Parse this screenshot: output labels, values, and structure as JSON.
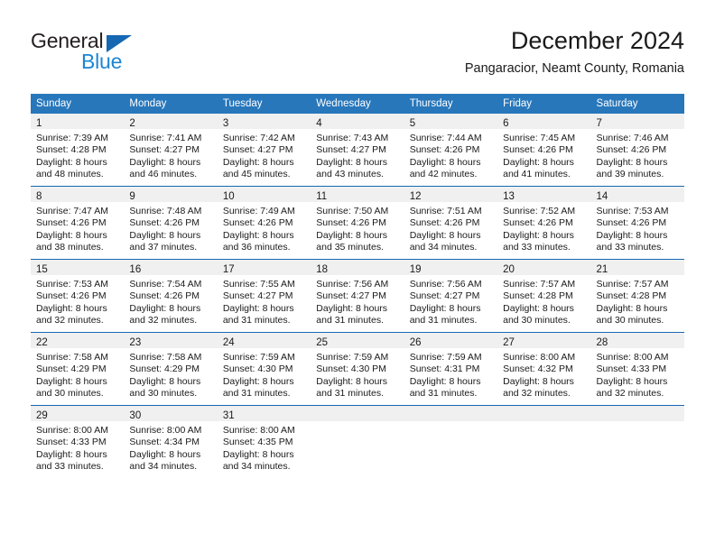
{
  "brand": {
    "name_top": "General",
    "name_bottom": "Blue",
    "color_dark": "#231f20",
    "color_blue": "#1b86d4"
  },
  "header": {
    "title": "December 2024",
    "subtitle": "Pangaracior, Neamt County, Romania"
  },
  "theme": {
    "header_bg": "#2877bb",
    "header_text": "#ffffff",
    "row_divider": "#1668b3",
    "daynum_bg": "#f0f0f0"
  },
  "weekdays": [
    "Sunday",
    "Monday",
    "Tuesday",
    "Wednesday",
    "Thursday",
    "Friday",
    "Saturday"
  ],
  "labels": {
    "sunrise_prefix": "Sunrise:",
    "sunset_prefix": "Sunset:",
    "daylight_prefix": "Daylight:"
  },
  "weeks": [
    [
      {
        "day": "1",
        "l1": "Sunrise: 7:39 AM",
        "l2": "Sunset: 4:28 PM",
        "l3": "Daylight: 8 hours",
        "l4": "and 48 minutes."
      },
      {
        "day": "2",
        "l1": "Sunrise: 7:41 AM",
        "l2": "Sunset: 4:27 PM",
        "l3": "Daylight: 8 hours",
        "l4": "and 46 minutes."
      },
      {
        "day": "3",
        "l1": "Sunrise: 7:42 AM",
        "l2": "Sunset: 4:27 PM",
        "l3": "Daylight: 8 hours",
        "l4": "and 45 minutes."
      },
      {
        "day": "4",
        "l1": "Sunrise: 7:43 AM",
        "l2": "Sunset: 4:27 PM",
        "l3": "Daylight: 8 hours",
        "l4": "and 43 minutes."
      },
      {
        "day": "5",
        "l1": "Sunrise: 7:44 AM",
        "l2": "Sunset: 4:26 PM",
        "l3": "Daylight: 8 hours",
        "l4": "and 42 minutes."
      },
      {
        "day": "6",
        "l1": "Sunrise: 7:45 AM",
        "l2": "Sunset: 4:26 PM",
        "l3": "Daylight: 8 hours",
        "l4": "and 41 minutes."
      },
      {
        "day": "7",
        "l1": "Sunrise: 7:46 AM",
        "l2": "Sunset: 4:26 PM",
        "l3": "Daylight: 8 hours",
        "l4": "and 39 minutes."
      }
    ],
    [
      {
        "day": "8",
        "l1": "Sunrise: 7:47 AM",
        "l2": "Sunset: 4:26 PM",
        "l3": "Daylight: 8 hours",
        "l4": "and 38 minutes."
      },
      {
        "day": "9",
        "l1": "Sunrise: 7:48 AM",
        "l2": "Sunset: 4:26 PM",
        "l3": "Daylight: 8 hours",
        "l4": "and 37 minutes."
      },
      {
        "day": "10",
        "l1": "Sunrise: 7:49 AM",
        "l2": "Sunset: 4:26 PM",
        "l3": "Daylight: 8 hours",
        "l4": "and 36 minutes."
      },
      {
        "day": "11",
        "l1": "Sunrise: 7:50 AM",
        "l2": "Sunset: 4:26 PM",
        "l3": "Daylight: 8 hours",
        "l4": "and 35 minutes."
      },
      {
        "day": "12",
        "l1": "Sunrise: 7:51 AM",
        "l2": "Sunset: 4:26 PM",
        "l3": "Daylight: 8 hours",
        "l4": "and 34 minutes."
      },
      {
        "day": "13",
        "l1": "Sunrise: 7:52 AM",
        "l2": "Sunset: 4:26 PM",
        "l3": "Daylight: 8 hours",
        "l4": "and 33 minutes."
      },
      {
        "day": "14",
        "l1": "Sunrise: 7:53 AM",
        "l2": "Sunset: 4:26 PM",
        "l3": "Daylight: 8 hours",
        "l4": "and 33 minutes."
      }
    ],
    [
      {
        "day": "15",
        "l1": "Sunrise: 7:53 AM",
        "l2": "Sunset: 4:26 PM",
        "l3": "Daylight: 8 hours",
        "l4": "and 32 minutes."
      },
      {
        "day": "16",
        "l1": "Sunrise: 7:54 AM",
        "l2": "Sunset: 4:26 PM",
        "l3": "Daylight: 8 hours",
        "l4": "and 32 minutes."
      },
      {
        "day": "17",
        "l1": "Sunrise: 7:55 AM",
        "l2": "Sunset: 4:27 PM",
        "l3": "Daylight: 8 hours",
        "l4": "and 31 minutes."
      },
      {
        "day": "18",
        "l1": "Sunrise: 7:56 AM",
        "l2": "Sunset: 4:27 PM",
        "l3": "Daylight: 8 hours",
        "l4": "and 31 minutes."
      },
      {
        "day": "19",
        "l1": "Sunrise: 7:56 AM",
        "l2": "Sunset: 4:27 PM",
        "l3": "Daylight: 8 hours",
        "l4": "and 31 minutes."
      },
      {
        "day": "20",
        "l1": "Sunrise: 7:57 AM",
        "l2": "Sunset: 4:28 PM",
        "l3": "Daylight: 8 hours",
        "l4": "and 30 minutes."
      },
      {
        "day": "21",
        "l1": "Sunrise: 7:57 AM",
        "l2": "Sunset: 4:28 PM",
        "l3": "Daylight: 8 hours",
        "l4": "and 30 minutes."
      }
    ],
    [
      {
        "day": "22",
        "l1": "Sunrise: 7:58 AM",
        "l2": "Sunset: 4:29 PM",
        "l3": "Daylight: 8 hours",
        "l4": "and 30 minutes."
      },
      {
        "day": "23",
        "l1": "Sunrise: 7:58 AM",
        "l2": "Sunset: 4:29 PM",
        "l3": "Daylight: 8 hours",
        "l4": "and 30 minutes."
      },
      {
        "day": "24",
        "l1": "Sunrise: 7:59 AM",
        "l2": "Sunset: 4:30 PM",
        "l3": "Daylight: 8 hours",
        "l4": "and 31 minutes."
      },
      {
        "day": "25",
        "l1": "Sunrise: 7:59 AM",
        "l2": "Sunset: 4:30 PM",
        "l3": "Daylight: 8 hours",
        "l4": "and 31 minutes."
      },
      {
        "day": "26",
        "l1": "Sunrise: 7:59 AM",
        "l2": "Sunset: 4:31 PM",
        "l3": "Daylight: 8 hours",
        "l4": "and 31 minutes."
      },
      {
        "day": "27",
        "l1": "Sunrise: 8:00 AM",
        "l2": "Sunset: 4:32 PM",
        "l3": "Daylight: 8 hours",
        "l4": "and 32 minutes."
      },
      {
        "day": "28",
        "l1": "Sunrise: 8:00 AM",
        "l2": "Sunset: 4:33 PM",
        "l3": "Daylight: 8 hours",
        "l4": "and 32 minutes."
      }
    ],
    [
      {
        "day": "29",
        "l1": "Sunrise: 8:00 AM",
        "l2": "Sunset: 4:33 PM",
        "l3": "Daylight: 8 hours",
        "l4": "and 33 minutes."
      },
      {
        "day": "30",
        "l1": "Sunrise: 8:00 AM",
        "l2": "Sunset: 4:34 PM",
        "l3": "Daylight: 8 hours",
        "l4": "and 34 minutes."
      },
      {
        "day": "31",
        "l1": "Sunrise: 8:00 AM",
        "l2": "Sunset: 4:35 PM",
        "l3": "Daylight: 8 hours",
        "l4": "and 34 minutes."
      },
      {
        "day": "",
        "l1": "",
        "l2": "",
        "l3": "",
        "l4": ""
      },
      {
        "day": "",
        "l1": "",
        "l2": "",
        "l3": "",
        "l4": ""
      },
      {
        "day": "",
        "l1": "",
        "l2": "",
        "l3": "",
        "l4": ""
      },
      {
        "day": "",
        "l1": "",
        "l2": "",
        "l3": "",
        "l4": ""
      }
    ]
  ]
}
